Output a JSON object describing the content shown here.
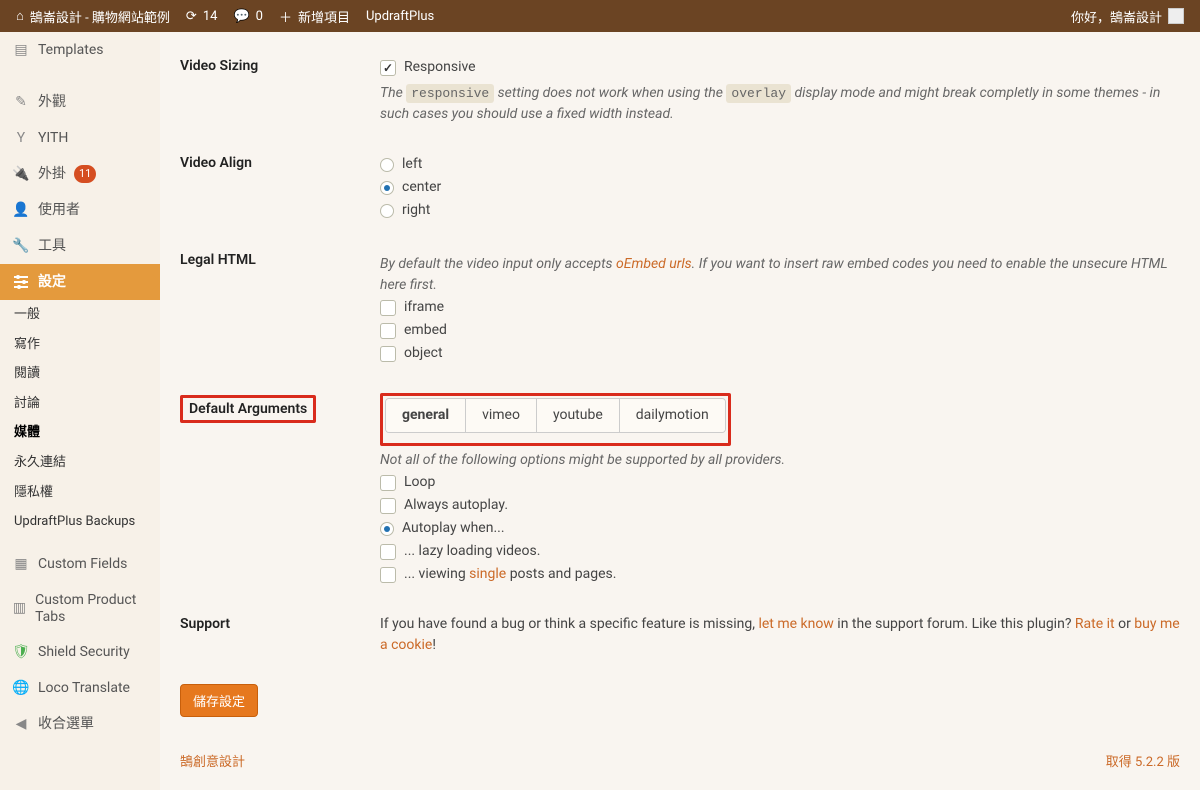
{
  "adminbar": {
    "site_name": "鵠崙設計 - 購物網站範例",
    "updates_count": "14",
    "comments_count": "0",
    "new_label": "新增項目",
    "updraft": "UpdraftPlus",
    "greeting": "你好，鵠崙設計"
  },
  "sidebar": {
    "templates": "Templates",
    "appearance": "外觀",
    "yith": "YITH",
    "plugins": "外掛",
    "plugins_badge": "11",
    "users": "使用者",
    "tools": "工具",
    "settings": "設定",
    "sub": {
      "general": "一般",
      "writing": "寫作",
      "reading": "閱讀",
      "discussion": "討論",
      "media": "媒體",
      "permalinks": "永久連結",
      "privacy": "隱私權",
      "updraft": "UpdraftPlus Backups"
    },
    "custom_fields": "Custom Fields",
    "custom_tabs": "Custom Product Tabs",
    "shield": "Shield Security",
    "loco": "Loco Translate",
    "collapse": "收合選單"
  },
  "form": {
    "video_sizing": {
      "label": "Video Sizing",
      "responsive_label": "Responsive",
      "desc_1": "The ",
      "desc_code1": "responsive",
      "desc_2": " setting does not work when using the ",
      "desc_code2": "overlay",
      "desc_3": " display mode and might break completly in some themes - in such cases you should use a fixed width instead."
    },
    "video_align": {
      "label": "Video Align",
      "opts": {
        "left": "left",
        "center": "center",
        "right": "right"
      }
    },
    "legal_html": {
      "label": "Legal HTML",
      "desc_1": "By default the video input only accepts ",
      "link": "oEmbed urls",
      "desc_2": ". If you want to insert raw embed codes you need to enable the unsecure HTML here first.",
      "opts": {
        "iframe": "iframe",
        "embed": "embed",
        "object": "object"
      }
    },
    "default_args": {
      "label": "Default Arguments",
      "tabs": {
        "general": "general",
        "vimeo": "vimeo",
        "youtube": "youtube",
        "dailymotion": "dailymotion"
      },
      "desc": "Not all of the following options might be supported by all providers.",
      "opts": {
        "loop": "Loop",
        "always_autoplay": "Always autoplay.",
        "autoplay_when": "Autoplay when...",
        "lazy": "... lazy loading videos.",
        "viewing_1": "... viewing ",
        "viewing_link": "single",
        "viewing_2": " posts and pages."
      }
    },
    "support": {
      "label": "Support",
      "text_1": "If you have found a bug or think a specific feature is missing, ",
      "link1": "let me know",
      "text_2": " in the support forum. Like this plugin? ",
      "link2": "Rate it",
      "text_3": " or ",
      "link3": "buy me a cookie",
      "text_4": "!"
    },
    "save": "儲存設定"
  },
  "footer": {
    "credit": "鵠創意設計",
    "version": "取得 5.2.2 版"
  }
}
